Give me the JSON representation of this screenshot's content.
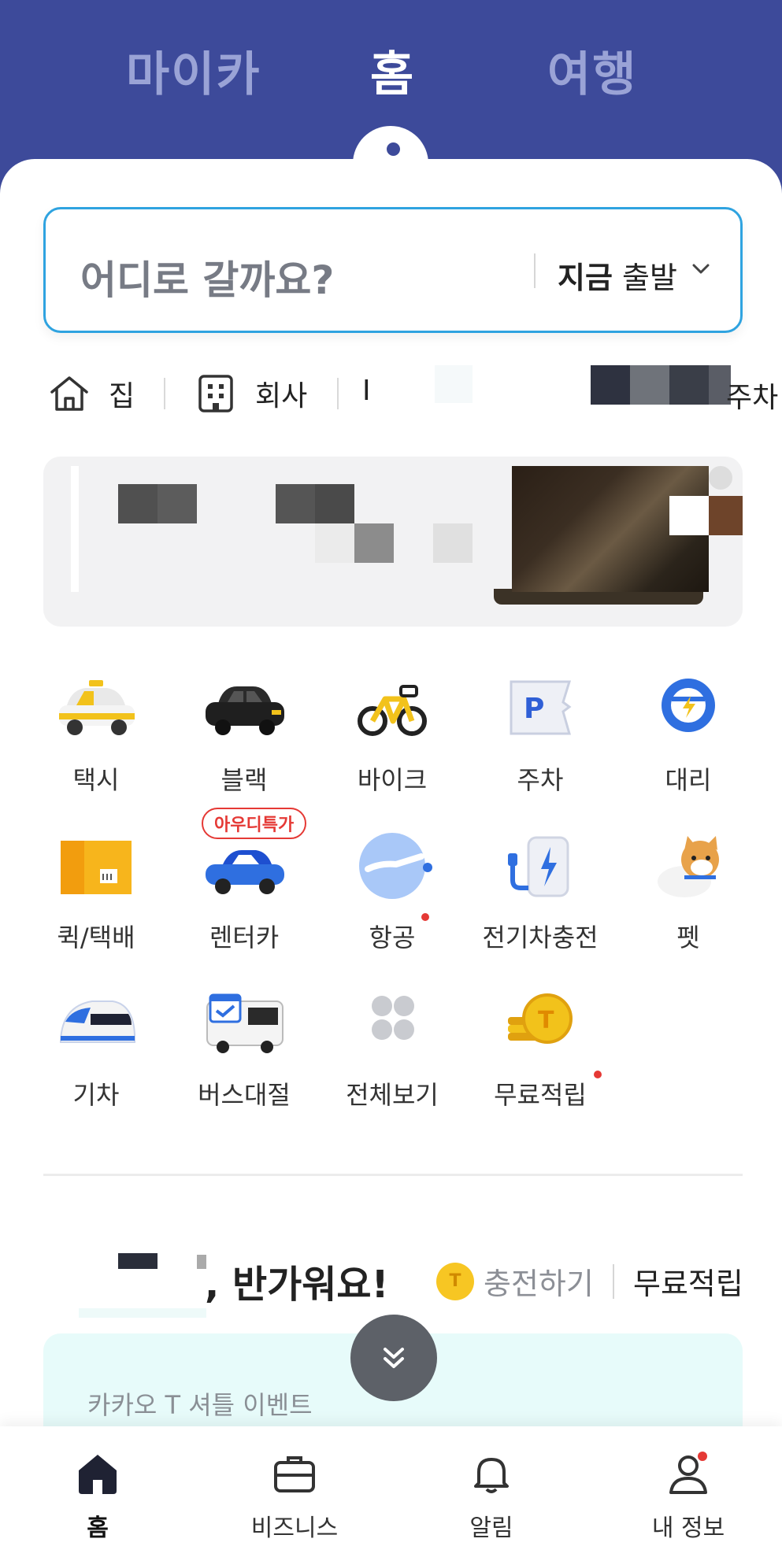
{
  "top_tabs": {
    "mycar": "마이카",
    "home": "홈",
    "travel": "여행"
  },
  "search": {
    "placeholder": "어디로 갈까요?",
    "depart_bold": "지금",
    "depart_rest": "출발"
  },
  "favorites": {
    "home": "집",
    "work": "회사",
    "extra": "I",
    "parking": "주차"
  },
  "services": [
    {
      "label": "택시",
      "icon": "taxi-icon"
    },
    {
      "label": "블랙",
      "icon": "black-car-icon"
    },
    {
      "label": "바이크",
      "icon": "bike-icon"
    },
    {
      "label": "주차",
      "icon": "parking-icon"
    },
    {
      "label": "대리",
      "icon": "steering-wheel-icon"
    },
    {
      "label": "퀵/택배",
      "icon": "box-icon"
    },
    {
      "label": "렌터카",
      "icon": "rental-car-icon"
    },
    {
      "label": "항공",
      "icon": "airplane-icon"
    },
    {
      "label": "전기차충전",
      "icon": "ev-charger-icon"
    },
    {
      "label": "펫",
      "icon": "dog-icon"
    },
    {
      "label": "기차",
      "icon": "train-icon"
    },
    {
      "label": "버스대절",
      "icon": "bus-icon"
    },
    {
      "label": "전체보기",
      "icon": "grid-icon"
    },
    {
      "label": "무료적립",
      "icon": "coins-icon"
    }
  ],
  "rental_badge": "아우디특가",
  "greeting": {
    "text": ", 반가워요!",
    "coin_letter": "T",
    "charge": "충전하기",
    "free_save": "무료적립"
  },
  "event": {
    "text": "카카오 T 셔틀 이벤트"
  },
  "bottom_nav": [
    {
      "label": "홈",
      "icon": "home-icon"
    },
    {
      "label": "비즈니스",
      "icon": "briefcase-icon"
    },
    {
      "label": "알림",
      "icon": "bell-icon"
    },
    {
      "label": "내 정보",
      "icon": "person-icon"
    }
  ],
  "colors": {
    "brand": "#3d4a9a",
    "search_border": "#2fa3e0",
    "alert": "#e53935",
    "event_bg": "#e7fbfa"
  }
}
